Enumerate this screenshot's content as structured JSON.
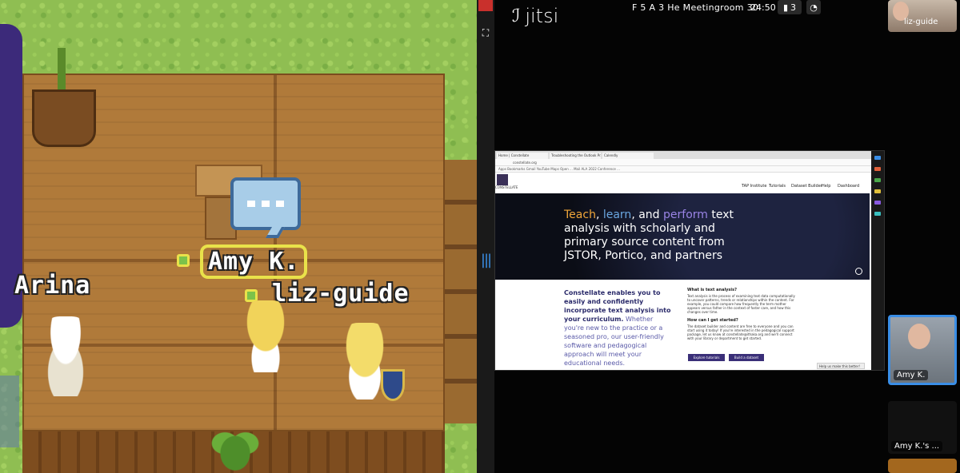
{
  "game": {
    "names": {
      "amy": "Amy K.",
      "liz": "liz-guide",
      "arina": "Arina"
    }
  },
  "divider": {
    "expand_icon": "fullscreen-icon",
    "handle_icon": "drag-handle-icon"
  },
  "meet": {
    "brand": "jitsi",
    "room_name": "F 5 A 3 He Meetingroom 30",
    "timer": "24:50",
    "participant_count": "3",
    "tiles": {
      "liz": "liz-guide",
      "amy": "Amy K.",
      "amy_screen": "Amy K.'s ..."
    }
  },
  "shared_screen": {
    "browser_tabs": [
      "Home | Constellate",
      "Troubleshooting the Outlook Pr...",
      "Calendly"
    ],
    "url": "constellate.org",
    "bookmarks": "Apps  Bookmarks  Gmail  YouTube  Maps  Open  ...  Mail  ALA 2022 Conference ...",
    "site": {
      "logo_text": "CONSTELLATE",
      "nav": [
        "TAP Institute",
        "Tutorials",
        "Dataset Builder",
        "Help",
        "Dashboard"
      ],
      "hero": {
        "w1": "Teach",
        "sep1": ", ",
        "w2": "learn",
        "sep2": ", and ",
        "w3": "perform",
        "rest": " text analysis with scholarly and primary source content from JSTOR, Portico, and partners"
      },
      "intro_bold": "Constellate enables you to easily and confidently incorporate text analysis into your curriculum.",
      "intro_rest": " Whether you're new to the practice or a seasoned pro, our user-friendly software and pedagogical approach will meet your educational needs.",
      "q1": "What is text analysis?",
      "a1": "Text analysis is the process of examining text data computationally to uncover patterns, trends or relationships within the content. For example, you could compare how frequently the term mother appears versus father in the context of foster care, and how this changes over time.",
      "q2": "How can I get started?",
      "a2": "The dataset builder and content are free to everyone and you can start using it today! If you're interested in the pedagogical support package, let us know at constellate@ithaka.org and we'll connect with your library or department to get started.",
      "btn1": "Explore tutorials",
      "btn2": "Build a dataset",
      "help": "Help us make this better!"
    }
  }
}
